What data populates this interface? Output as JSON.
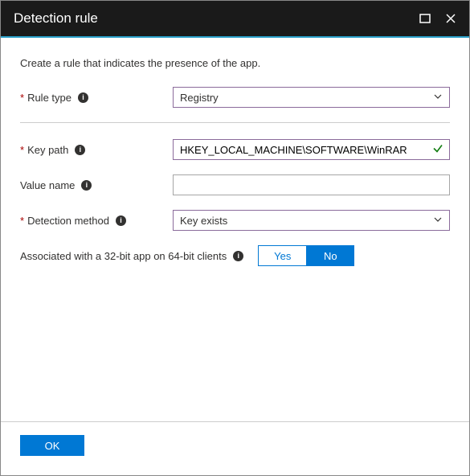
{
  "header": {
    "title": "Detection rule"
  },
  "description": "Create a rule that indicates the presence of the app.",
  "fields": {
    "ruleType": {
      "label": "Rule type",
      "value": "Registry"
    },
    "keyPath": {
      "label": "Key path",
      "value": "HKEY_LOCAL_MACHINE\\SOFTWARE\\WinRAR"
    },
    "valueName": {
      "label": "Value name",
      "value": ""
    },
    "detectionMethod": {
      "label": "Detection method",
      "value": "Key exists"
    }
  },
  "associated": {
    "label": "Associated with a 32-bit app on 64-bit clients",
    "yes": "Yes",
    "no": "No"
  },
  "footer": {
    "ok": "OK"
  }
}
